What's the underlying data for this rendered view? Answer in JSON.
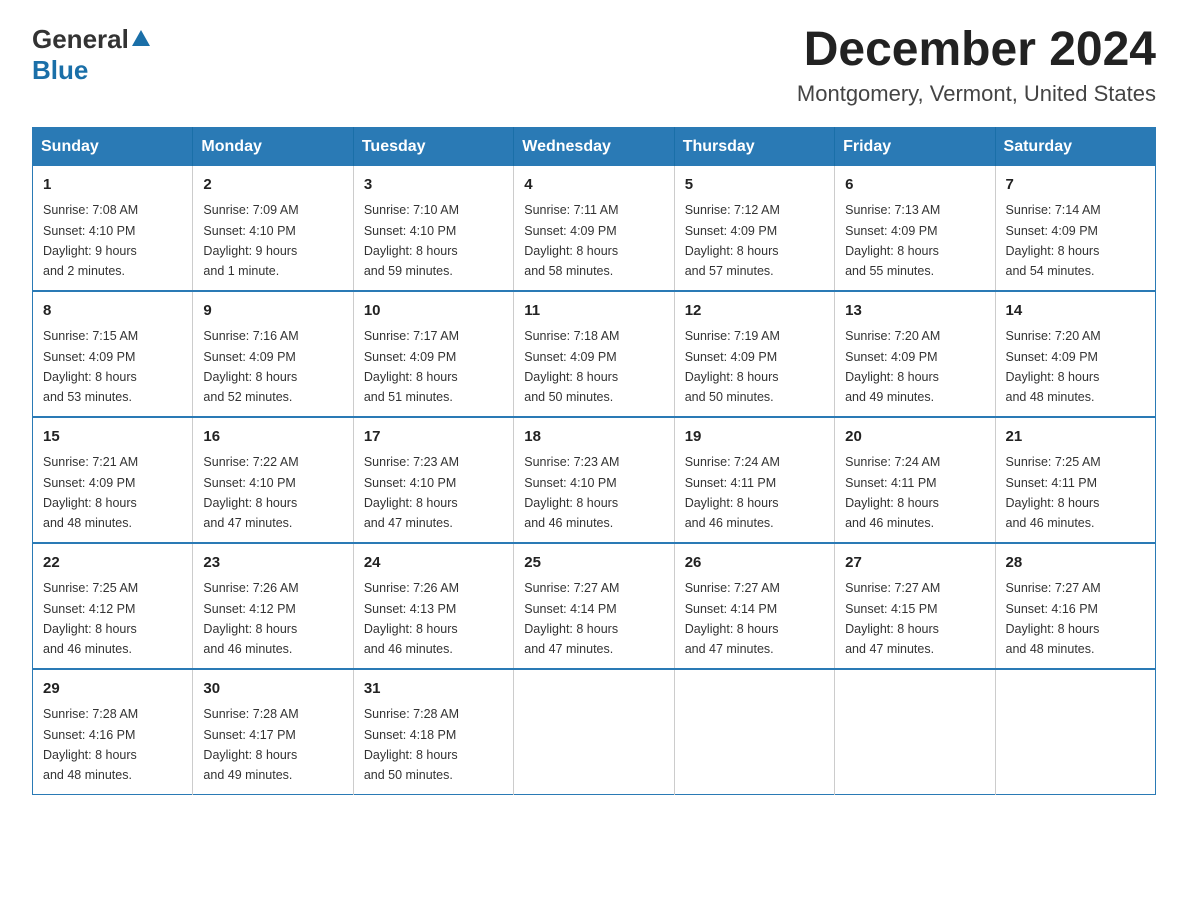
{
  "header": {
    "logo_line1": "General",
    "logo_line2": "Blue",
    "month_title": "December 2024",
    "location": "Montgomery, Vermont, United States"
  },
  "weekdays": [
    "Sunday",
    "Monday",
    "Tuesday",
    "Wednesday",
    "Thursday",
    "Friday",
    "Saturday"
  ],
  "weeks": [
    [
      {
        "day": "1",
        "sunrise": "7:08 AM",
        "sunset": "4:10 PM",
        "daylight": "9 hours and 2 minutes."
      },
      {
        "day": "2",
        "sunrise": "7:09 AM",
        "sunset": "4:10 PM",
        "daylight": "9 hours and 1 minute."
      },
      {
        "day": "3",
        "sunrise": "7:10 AM",
        "sunset": "4:10 PM",
        "daylight": "8 hours and 59 minutes."
      },
      {
        "day": "4",
        "sunrise": "7:11 AM",
        "sunset": "4:09 PM",
        "daylight": "8 hours and 58 minutes."
      },
      {
        "day": "5",
        "sunrise": "7:12 AM",
        "sunset": "4:09 PM",
        "daylight": "8 hours and 57 minutes."
      },
      {
        "day": "6",
        "sunrise": "7:13 AM",
        "sunset": "4:09 PM",
        "daylight": "8 hours and 55 minutes."
      },
      {
        "day": "7",
        "sunrise": "7:14 AM",
        "sunset": "4:09 PM",
        "daylight": "8 hours and 54 minutes."
      }
    ],
    [
      {
        "day": "8",
        "sunrise": "7:15 AM",
        "sunset": "4:09 PM",
        "daylight": "8 hours and 53 minutes."
      },
      {
        "day": "9",
        "sunrise": "7:16 AM",
        "sunset": "4:09 PM",
        "daylight": "8 hours and 52 minutes."
      },
      {
        "day": "10",
        "sunrise": "7:17 AM",
        "sunset": "4:09 PM",
        "daylight": "8 hours and 51 minutes."
      },
      {
        "day": "11",
        "sunrise": "7:18 AM",
        "sunset": "4:09 PM",
        "daylight": "8 hours and 50 minutes."
      },
      {
        "day": "12",
        "sunrise": "7:19 AM",
        "sunset": "4:09 PM",
        "daylight": "8 hours and 50 minutes."
      },
      {
        "day": "13",
        "sunrise": "7:20 AM",
        "sunset": "4:09 PM",
        "daylight": "8 hours and 49 minutes."
      },
      {
        "day": "14",
        "sunrise": "7:20 AM",
        "sunset": "4:09 PM",
        "daylight": "8 hours and 48 minutes."
      }
    ],
    [
      {
        "day": "15",
        "sunrise": "7:21 AM",
        "sunset": "4:09 PM",
        "daylight": "8 hours and 48 minutes."
      },
      {
        "day": "16",
        "sunrise": "7:22 AM",
        "sunset": "4:10 PM",
        "daylight": "8 hours and 47 minutes."
      },
      {
        "day": "17",
        "sunrise": "7:23 AM",
        "sunset": "4:10 PM",
        "daylight": "8 hours and 47 minutes."
      },
      {
        "day": "18",
        "sunrise": "7:23 AM",
        "sunset": "4:10 PM",
        "daylight": "8 hours and 46 minutes."
      },
      {
        "day": "19",
        "sunrise": "7:24 AM",
        "sunset": "4:11 PM",
        "daylight": "8 hours and 46 minutes."
      },
      {
        "day": "20",
        "sunrise": "7:24 AM",
        "sunset": "4:11 PM",
        "daylight": "8 hours and 46 minutes."
      },
      {
        "day": "21",
        "sunrise": "7:25 AM",
        "sunset": "4:11 PM",
        "daylight": "8 hours and 46 minutes."
      }
    ],
    [
      {
        "day": "22",
        "sunrise": "7:25 AM",
        "sunset": "4:12 PM",
        "daylight": "8 hours and 46 minutes."
      },
      {
        "day": "23",
        "sunrise": "7:26 AM",
        "sunset": "4:12 PM",
        "daylight": "8 hours and 46 minutes."
      },
      {
        "day": "24",
        "sunrise": "7:26 AM",
        "sunset": "4:13 PM",
        "daylight": "8 hours and 46 minutes."
      },
      {
        "day": "25",
        "sunrise": "7:27 AM",
        "sunset": "4:14 PM",
        "daylight": "8 hours and 47 minutes."
      },
      {
        "day": "26",
        "sunrise": "7:27 AM",
        "sunset": "4:14 PM",
        "daylight": "8 hours and 47 minutes."
      },
      {
        "day": "27",
        "sunrise": "7:27 AM",
        "sunset": "4:15 PM",
        "daylight": "8 hours and 47 minutes."
      },
      {
        "day": "28",
        "sunrise": "7:27 AM",
        "sunset": "4:16 PM",
        "daylight": "8 hours and 48 minutes."
      }
    ],
    [
      {
        "day": "29",
        "sunrise": "7:28 AM",
        "sunset": "4:16 PM",
        "daylight": "8 hours and 48 minutes."
      },
      {
        "day": "30",
        "sunrise": "7:28 AM",
        "sunset": "4:17 PM",
        "daylight": "8 hours and 49 minutes."
      },
      {
        "day": "31",
        "sunrise": "7:28 AM",
        "sunset": "4:18 PM",
        "daylight": "8 hours and 50 minutes."
      },
      null,
      null,
      null,
      null
    ]
  ],
  "labels": {
    "sunrise": "Sunrise:",
    "sunset": "Sunset:",
    "daylight": "Daylight:"
  }
}
